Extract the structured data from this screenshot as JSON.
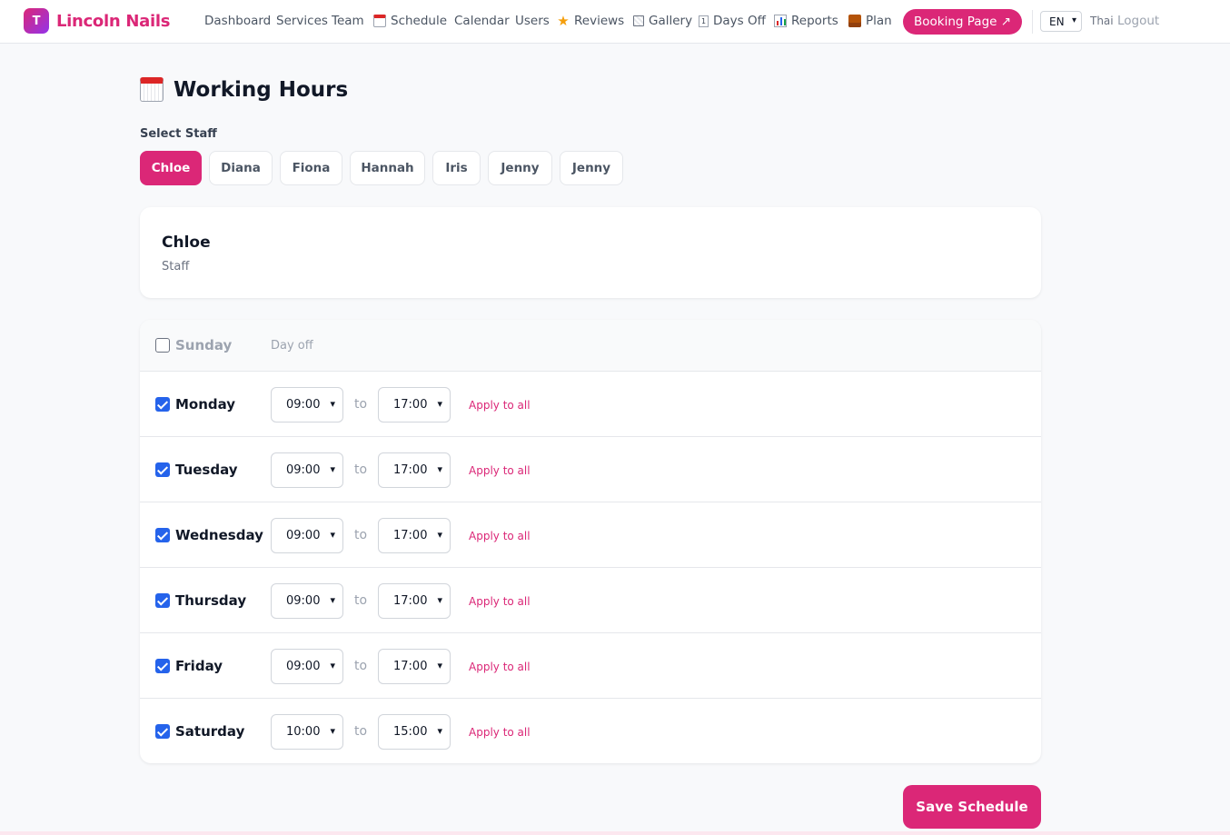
{
  "brand": {
    "logo_letter": "T",
    "name": "Lincoln Nails",
    "color": "#db2777"
  },
  "nav": {
    "items": [
      {
        "label": "Dashboard",
        "icon": ""
      },
      {
        "label": "Services",
        "icon": ""
      },
      {
        "label": "Team",
        "icon": ""
      },
      {
        "label": "Schedule",
        "icon": "calendar-icon"
      },
      {
        "label": "Calendar",
        "icon": ""
      },
      {
        "label": "Users",
        "icon": ""
      },
      {
        "label": "Reviews",
        "icon": "star-icon"
      },
      {
        "label": "Gallery",
        "icon": "framed-picture-icon"
      },
      {
        "label": "Days Off",
        "icon": "calendar-page-icon"
      },
      {
        "label": "Reports",
        "icon": "bar-chart-icon"
      },
      {
        "label": "Plan",
        "icon": "package-icon"
      }
    ],
    "booking_button": "Booking Page ↗",
    "language_value": "EN",
    "language_alt": "Thai",
    "logout": "Logout"
  },
  "page": {
    "title": "Working Hours",
    "select_staff_label": "Select Staff",
    "staff": [
      "Chloe",
      "Diana",
      "Fiona",
      "Hannah",
      "Iris",
      "Jenny",
      "Jenny"
    ],
    "selected_staff_index": 0
  },
  "staff_card": {
    "name": "Chloe",
    "role": "Staff"
  },
  "schedule": {
    "to_label": "to",
    "apply_label": "Apply to all",
    "day_off_label": "Day off",
    "days": [
      {
        "name": "Sunday",
        "enabled": false,
        "start": "",
        "end": ""
      },
      {
        "name": "Monday",
        "enabled": true,
        "start": "09:00",
        "end": "17:00"
      },
      {
        "name": "Tuesday",
        "enabled": true,
        "start": "09:00",
        "end": "17:00"
      },
      {
        "name": "Wednesday",
        "enabled": true,
        "start": "09:00",
        "end": "17:00"
      },
      {
        "name": "Thursday",
        "enabled": true,
        "start": "09:00",
        "end": "17:00"
      },
      {
        "name": "Friday",
        "enabled": true,
        "start": "09:00",
        "end": "17:00"
      },
      {
        "name": "Saturday",
        "enabled": true,
        "start": "10:00",
        "end": "15:00"
      }
    ]
  },
  "save_button": "Save Schedule",
  "colors": {
    "accent": "#db2777",
    "checkbox": "#2563eb"
  }
}
